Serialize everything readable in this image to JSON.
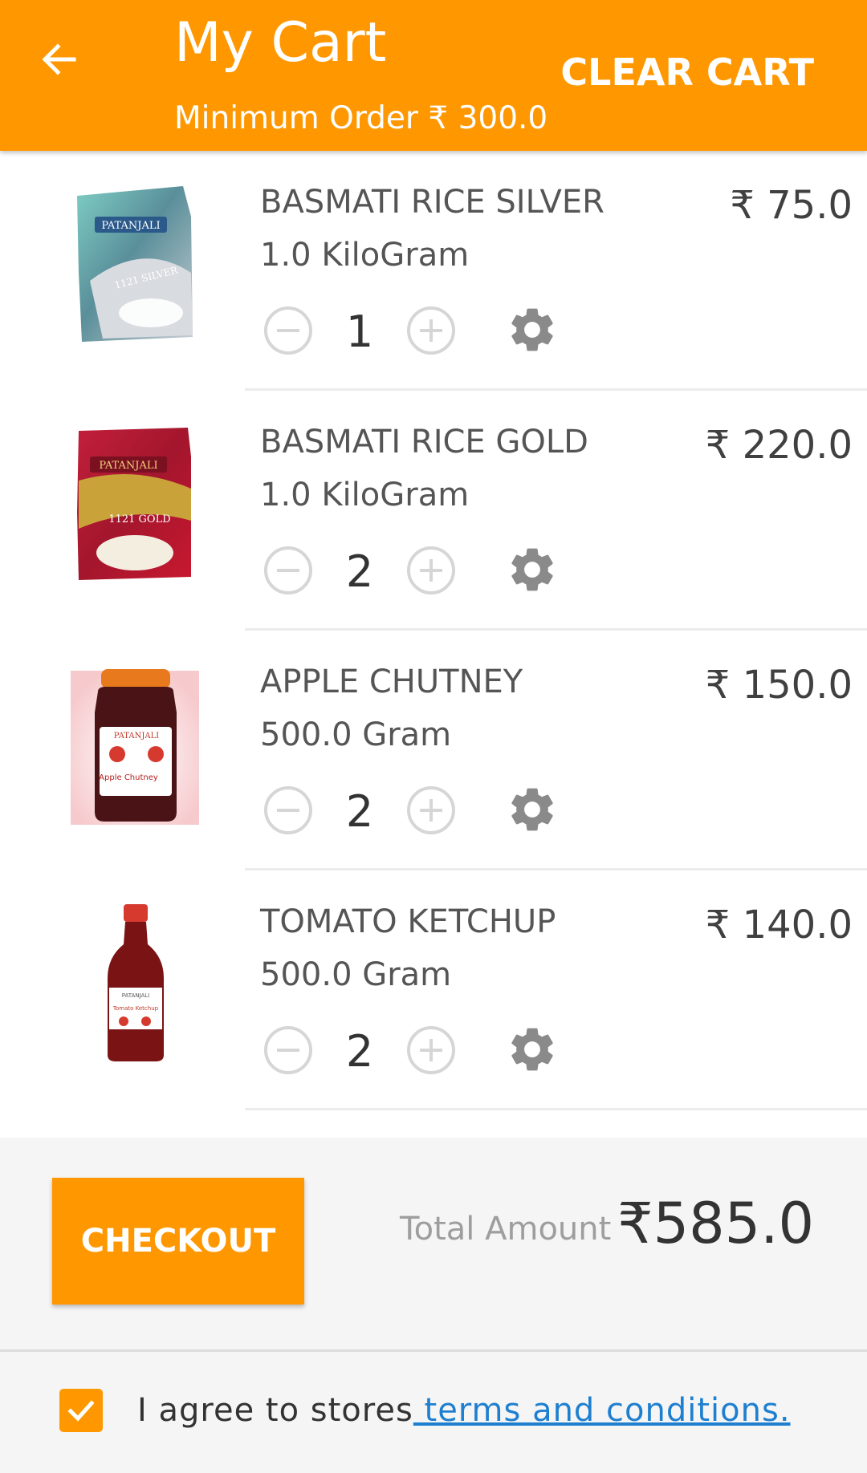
{
  "header": {
    "title": "My Cart",
    "subtitle": "Minimum Order ₹ 300.0",
    "clear_cart_label": "CLEAR CART",
    "back_icon": "arrow-left-icon"
  },
  "colors": {
    "accent": "#FF9800",
    "link": "#1E7FD0",
    "icon_gray": "#8a8a8a",
    "stepper_gray": "#d6d6d6"
  },
  "items": [
    {
      "name": "BASMATI RICE SILVER",
      "quantity_unit": "1.0 KiloGram",
      "price": "₹ 75.0",
      "quantity": "1",
      "image": "basmati-rice-silver-bag",
      "image_brand": "PATANJALI",
      "image_label": "1121 SILVER"
    },
    {
      "name": "BASMATI RICE GOLD",
      "quantity_unit": "1.0 KiloGram",
      "price": "₹ 220.0",
      "quantity": "2",
      "image": "basmati-rice-gold-bag",
      "image_brand": "PATANJALI",
      "image_label": "1121 GOLD"
    },
    {
      "name": "APPLE CHUTNEY",
      "quantity_unit": "500.0 Gram",
      "price": "₹ 150.0",
      "quantity": "2",
      "image": "apple-chutney-jar",
      "image_brand": "PATANJALI",
      "image_label": "Apple Chutney"
    },
    {
      "name": "TOMATO KETCHUP",
      "quantity_unit": "500.0 Gram",
      "price": "₹ 140.0",
      "quantity": "2",
      "image": "tomato-ketchup-bottle",
      "image_brand": "PATANJALI",
      "image_label": "Tomato Ketchup"
    }
  ],
  "footer": {
    "checkout_label": "CHECKOUT",
    "total_label": "Total Amount",
    "total_value": "₹585.0",
    "agree_text": "I agree to stores",
    "terms_link": " terms and conditions.",
    "checkbox_checked": true
  }
}
